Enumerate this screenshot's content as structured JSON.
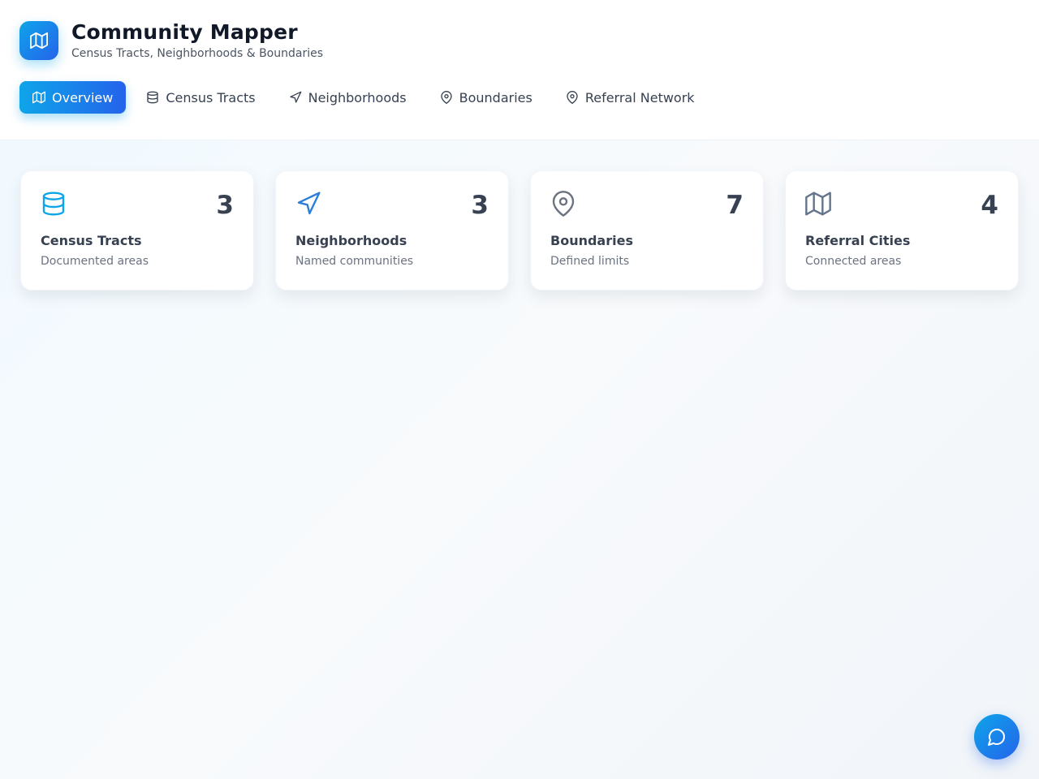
{
  "app": {
    "title": "Community Mapper",
    "subtitle": "Census Tracts, Neighborhoods & Boundaries",
    "logo_icon": "map-icon",
    "accent": "#0ea5e9",
    "accent_dark": "#2563eb"
  },
  "tabs": [
    {
      "label": "Overview",
      "icon": "map-icon",
      "active": true
    },
    {
      "label": "Census Tracts",
      "icon": "database-icon",
      "active": false
    },
    {
      "label": "Neighborhoods",
      "icon": "navigation-icon",
      "active": false
    },
    {
      "label": "Boundaries",
      "icon": "map-pin-icon",
      "active": false
    },
    {
      "label": "Referral Network",
      "icon": "map-pin-icon",
      "active": false
    }
  ],
  "cards": [
    {
      "count": "3",
      "title": "Census Tracts",
      "desc": "Documented areas",
      "icon": "database-icon",
      "icon_color": "#0ea5e9"
    },
    {
      "count": "3",
      "title": "Neighborhoods",
      "desc": "Named communities",
      "icon": "navigation-icon",
      "icon_color": "#2b7fd8"
    },
    {
      "count": "7",
      "title": "Boundaries",
      "desc": "Defined limits",
      "icon": "map-pin-icon",
      "icon_color": "#6b7280"
    },
    {
      "count": "4",
      "title": "Referral Cities",
      "desc": "Connected areas",
      "icon": "map-icon",
      "icon_color": "#64748b"
    }
  ],
  "chat": {
    "icon": "message-circle-icon"
  }
}
